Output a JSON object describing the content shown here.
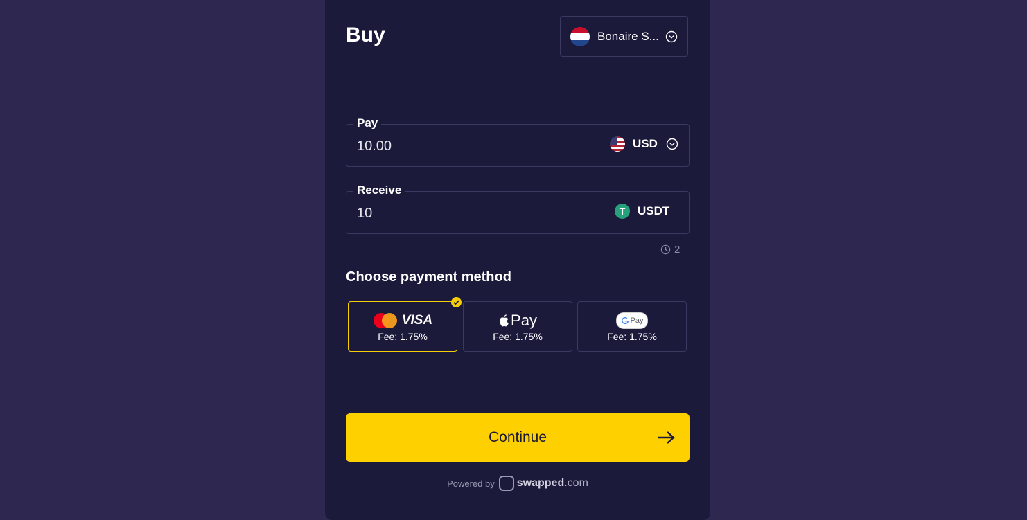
{
  "header": {
    "title": "Buy",
    "region": "Bonaire S...",
    "region_flag_icon": "netherlands-flag-icon"
  },
  "pay": {
    "label": "Pay",
    "value": "10.00",
    "currency": "USD",
    "currency_icon": "us-flag-icon"
  },
  "receive": {
    "label": "Receive",
    "value": "10",
    "currency": "USDT",
    "currency_icon": "tether-icon"
  },
  "timer": {
    "value": "2",
    "icon": "clock-icon"
  },
  "payment": {
    "title": "Choose payment method",
    "methods": [
      {
        "name": "card",
        "brand_text": "VISA",
        "fee": "Fee: 1.75%",
        "selected": true
      },
      {
        "name": "apple-pay",
        "brand_text": "Pay",
        "fee": "Fee: 1.75%",
        "selected": false
      },
      {
        "name": "google-pay",
        "brand_text": "Pay",
        "fee": "Fee: 1.75%",
        "selected": false
      }
    ]
  },
  "continue": {
    "label": "Continue"
  },
  "footer": {
    "powered_by": "Powered by",
    "brand_bold": "swapped",
    "brand_suffix": ".com"
  },
  "colors": {
    "accent": "#ffd000",
    "background": "#2e2851",
    "card": "#1b1a3a"
  }
}
